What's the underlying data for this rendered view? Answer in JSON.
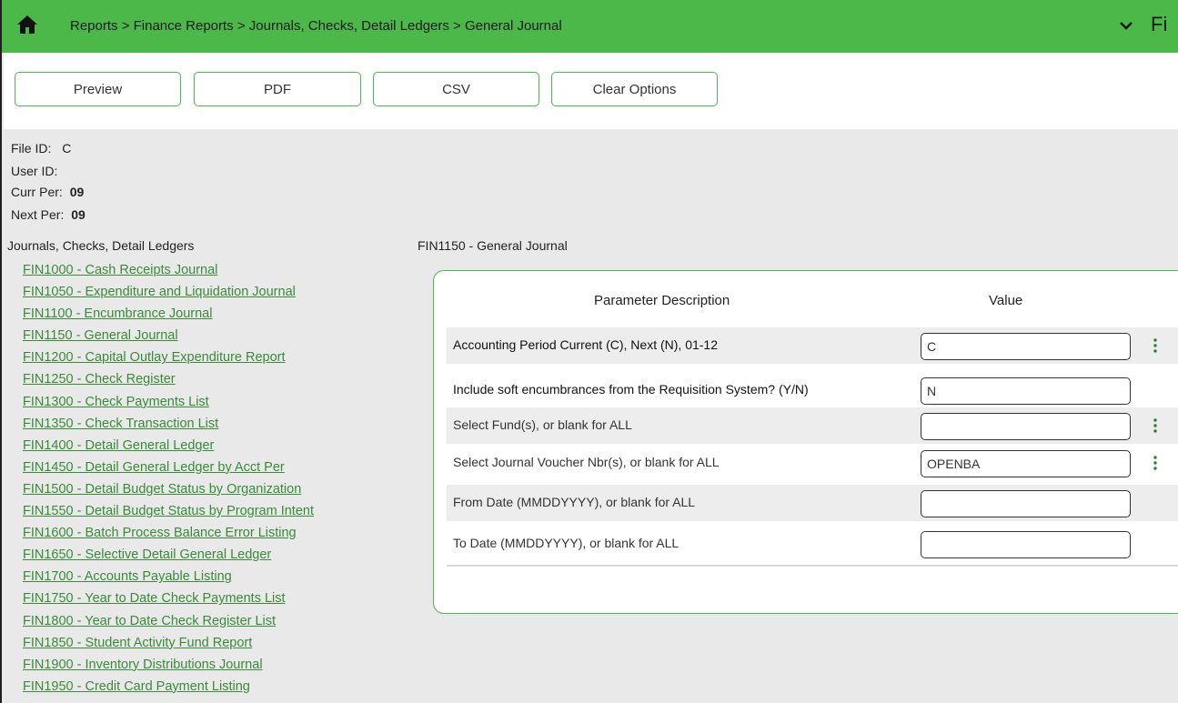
{
  "header": {
    "breadcrumb": "Reports > Finance Reports > Journals, Checks, Detail Ledgers > General Journal",
    "module_label": "Fi",
    "accent_color": "#4cb849"
  },
  "toolbar": {
    "preview_label": "Preview",
    "pdf_label": "PDF",
    "csv_label": "CSV",
    "clear_label": "Clear Options"
  },
  "info": {
    "file_id_label": "File ID:",
    "file_id_value": "C",
    "user_id_label": "User ID:",
    "user_id_value": "",
    "curr_per_label": "Curr Per:",
    "curr_per_value": "09",
    "next_per_label": "Next Per:",
    "next_per_value": "09"
  },
  "report_list": {
    "title": "Journals, Checks, Detail Ledgers",
    "items": [
      "FIN1000 - Cash Receipts Journal",
      "FIN1050 - Expenditure and Liquidation Journal",
      "FIN1100 - Encumbrance Journal",
      "FIN1150 - General Journal",
      "FIN1200 - Capital Outlay Expenditure Report",
      "FIN1250 - Check Register",
      "FIN1300 - Check Payments List",
      "FIN1350 - Check Transaction List",
      "FIN1400 - Detail General Ledger",
      "FIN1450 - Detail General Ledger by Acct Per",
      "FIN1500 - Detail Budget Status by Organization",
      "FIN1550 - Detail Budget Status by Program Intent",
      "FIN1600 - Batch Process Balance Error Listing",
      "FIN1650 - Selective Detail General Ledger",
      "FIN1700 - Accounts Payable Listing",
      "FIN1750 - Year to Date Check Payments List",
      "FIN1800 - Year to Date Check Register List",
      "FIN1850 - Student Activity Fund Report",
      "FIN1900 - Inventory Distributions Journal",
      "FIN1950 - Credit Card Payment Listing"
    ]
  },
  "params": {
    "title": "FIN1150 - General Journal",
    "col_description": "Parameter Description",
    "col_value": "Value",
    "rows": [
      {
        "label": "Accounting Period Current (C), Next (N), 01-12",
        "value": "C",
        "bold": true,
        "kebab": true,
        "icon": "kebab-icon"
      },
      {
        "label": "Include soft encumbrances from the Requisition System? (Y/N)",
        "value": "N",
        "bold": true,
        "kebab": false
      },
      {
        "label": "Select Fund(s), or blank for ALL",
        "value": "",
        "bold": false,
        "kebab": true,
        "icon": "kebab-icon"
      },
      {
        "label": "Select Journal Voucher Nbr(s), or blank for ALL",
        "value": "OPENBA",
        "bold": false,
        "kebab": true,
        "icon": "kebab-icon"
      },
      {
        "label": "From Date (MMDDYYYY), or blank for ALL",
        "value": "",
        "bold": false,
        "kebab": false
      },
      {
        "label": "To Date (MMDDYYYY), or blank for ALL",
        "value": "",
        "bold": false,
        "kebab": false
      }
    ]
  }
}
